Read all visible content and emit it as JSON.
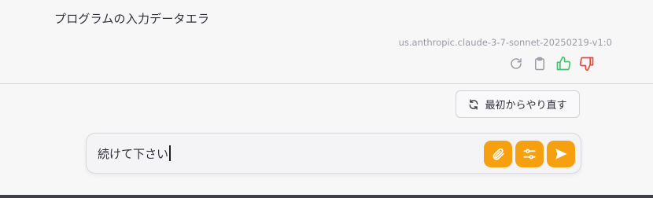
{
  "conversation": {
    "message_text": "プログラムの入力データエラ",
    "model_id": "us.anthropic.claude-3-7-sonnet-20250219-v1:0",
    "actions": [
      {
        "name": "retry-icon"
      },
      {
        "name": "copy-icon"
      },
      {
        "name": "thumbs-up-icon"
      },
      {
        "name": "thumbs-down-icon"
      }
    ]
  },
  "restart_button": {
    "label": "最初からやり直す",
    "icon": "refresh-icon"
  },
  "composer": {
    "input_value": "続けて下さい",
    "buttons": [
      {
        "name": "attach-button",
        "icon": "paperclip-icon"
      },
      {
        "name": "settings-button",
        "icon": "sliders-icon"
      },
      {
        "name": "send-button",
        "icon": "send-icon"
      }
    ]
  },
  "colors": {
    "accent": "#f7a00f",
    "thumbs_up": "#3ec46d",
    "thumbs_down": "#e8463c",
    "muted_icon": "#9a9aa6"
  }
}
